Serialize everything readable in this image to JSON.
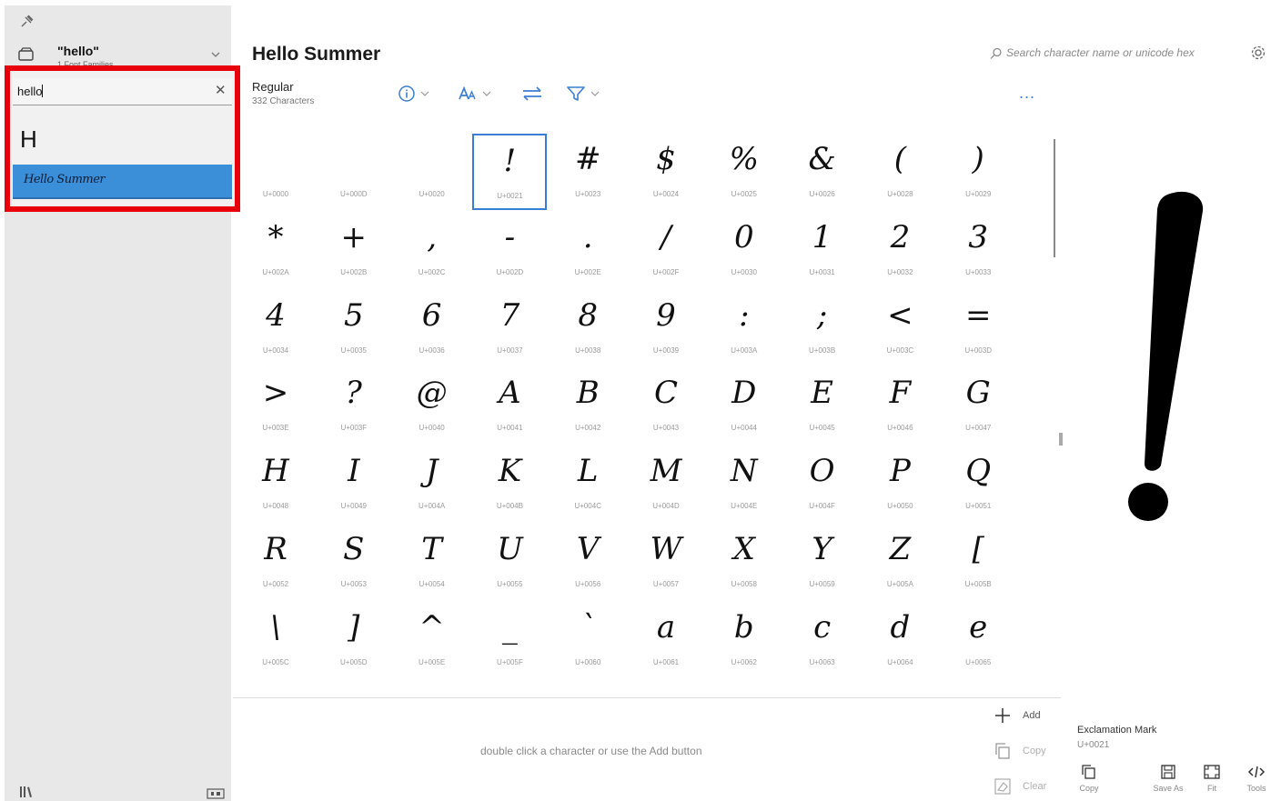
{
  "sidebar": {
    "collection_title": "\"hello\"",
    "collection_sub": "1 Font Families",
    "search_value": "hello",
    "suggestions": [
      "H",
      "Hello Summer"
    ]
  },
  "header": {
    "font_title": "Hello Summer",
    "search_placeholder": "Search character name or unicode hex",
    "style_name": "Regular",
    "char_count": "332 Characters",
    "more": "..."
  },
  "grid": {
    "selected_index": 2,
    "cells": [
      {
        "g": "",
        "c": "U+0000"
      },
      {
        "g": "",
        "c": "U+000D"
      },
      {
        "g": "",
        "c": "U+0020"
      },
      {
        "g": "!",
        "c": "U+0021"
      },
      {
        "g": "#",
        "c": "U+0023"
      },
      {
        "g": "$",
        "c": "U+0024"
      },
      {
        "g": "%",
        "c": "U+0025"
      },
      {
        "g": "&",
        "c": "U+0026"
      },
      {
        "g": "(",
        "c": "U+0028"
      },
      {
        "g": ")",
        "c": "U+0029"
      },
      {
        "g": "*",
        "c": "U+002A"
      },
      {
        "g": "+",
        "c": "U+002B"
      },
      {
        "g": ",",
        "c": "U+002C"
      },
      {
        "g": "-",
        "c": "U+002D"
      },
      {
        "g": ".",
        "c": "U+002E"
      },
      {
        "g": "/",
        "c": "U+002F"
      },
      {
        "g": "0",
        "c": "U+0030"
      },
      {
        "g": "1",
        "c": "U+0031"
      },
      {
        "g": "2",
        "c": "U+0032"
      },
      {
        "g": "3",
        "c": "U+0033"
      },
      {
        "g": "4",
        "c": "U+0034"
      },
      {
        "g": "5",
        "c": "U+0035"
      },
      {
        "g": "6",
        "c": "U+0036"
      },
      {
        "g": "7",
        "c": "U+0037"
      },
      {
        "g": "8",
        "c": "U+0038"
      },
      {
        "g": "9",
        "c": "U+0039"
      },
      {
        "g": ":",
        "c": "U+003A"
      },
      {
        "g": ";",
        "c": "U+003B"
      },
      {
        "g": "<",
        "c": "U+003C"
      },
      {
        "g": "=",
        "c": "U+003D"
      },
      {
        "g": ">",
        "c": "U+003E"
      },
      {
        "g": "?",
        "c": "U+003F"
      },
      {
        "g": "@",
        "c": "U+0040"
      },
      {
        "g": "A",
        "c": "U+0041"
      },
      {
        "g": "B",
        "c": "U+0042"
      },
      {
        "g": "C",
        "c": "U+0043"
      },
      {
        "g": "D",
        "c": "U+0044"
      },
      {
        "g": "E",
        "c": "U+0045"
      },
      {
        "g": "F",
        "c": "U+0046"
      },
      {
        "g": "G",
        "c": "U+0047"
      },
      {
        "g": "H",
        "c": "U+0048"
      },
      {
        "g": "I",
        "c": "U+0049"
      },
      {
        "g": "J",
        "c": "U+004A"
      },
      {
        "g": "K",
        "c": "U+004B"
      },
      {
        "g": "L",
        "c": "U+004C"
      },
      {
        "g": "M",
        "c": "U+004D"
      },
      {
        "g": "N",
        "c": "U+004E"
      },
      {
        "g": "O",
        "c": "U+004F"
      },
      {
        "g": "P",
        "c": "U+0050"
      },
      {
        "g": "Q",
        "c": "U+0051"
      },
      {
        "g": "R",
        "c": "U+0052"
      },
      {
        "g": "S",
        "c": "U+0053"
      },
      {
        "g": "T",
        "c": "U+0054"
      },
      {
        "g": "U",
        "c": "U+0055"
      },
      {
        "g": "V",
        "c": "U+0056"
      },
      {
        "g": "W",
        "c": "U+0057"
      },
      {
        "g": "X",
        "c": "U+0058"
      },
      {
        "g": "Y",
        "c": "U+0059"
      },
      {
        "g": "Z",
        "c": "U+005A"
      },
      {
        "g": "[",
        "c": "U+005B"
      },
      {
        "g": "\\",
        "c": "U+005C"
      },
      {
        "g": "]",
        "c": "U+005D"
      },
      {
        "g": "^",
        "c": "U+005E"
      },
      {
        "g": "_",
        "c": "U+005F"
      },
      {
        "g": "`",
        "c": "U+0060"
      },
      {
        "g": "a",
        "c": "U+0061"
      },
      {
        "g": "b",
        "c": "U+0062"
      },
      {
        "g": "c",
        "c": "U+0063"
      },
      {
        "g": "d",
        "c": "U+0064"
      },
      {
        "g": "e",
        "c": "U+0065"
      }
    ]
  },
  "preview": {
    "glyph": "!",
    "char_name": "Exclamation Mark",
    "char_code": "U+0021"
  },
  "actions": {
    "hint": "double click a character or use the Add button",
    "add": "Add",
    "copy": "Copy",
    "clear": "Clear"
  },
  "preview_buttons": {
    "copy": "Copy",
    "save_as": "Save As",
    "fit": "Fit",
    "tools": "Tools"
  },
  "colors": {
    "accent": "#3b7fd3",
    "highlight_border": "#e8000b",
    "selected_suggestion": "#3b8fd9"
  }
}
